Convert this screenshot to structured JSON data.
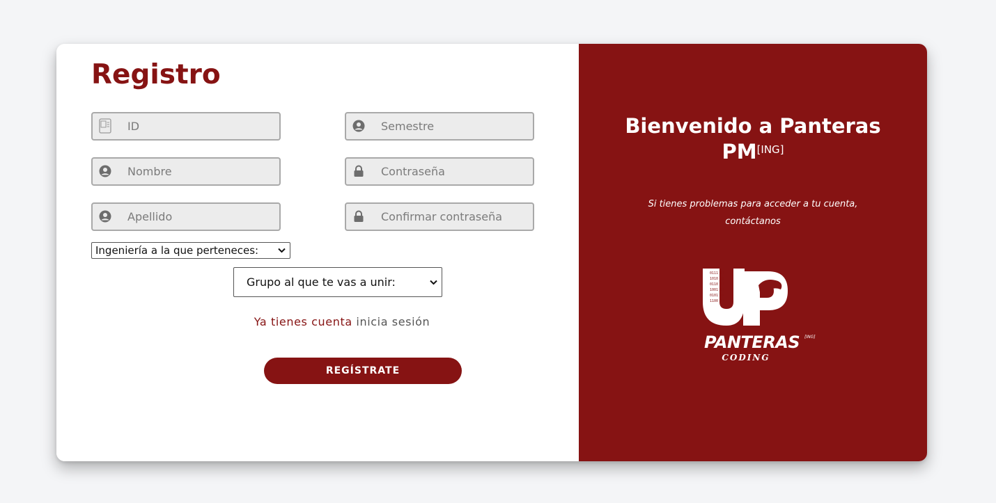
{
  "form": {
    "title": "Registro",
    "fields": {
      "id": {
        "placeholder": "ID",
        "icon": "id-card-icon"
      },
      "semestre": {
        "placeholder": "Semestre",
        "icon": "user-circle-icon"
      },
      "nombre": {
        "placeholder": "Nombre",
        "icon": "user-circle-icon"
      },
      "contrasena": {
        "placeholder": "Contraseña",
        "icon": "lock-icon"
      },
      "apellido": {
        "placeholder": "Apellido",
        "icon": "user-circle-icon"
      },
      "confirmar": {
        "placeholder": "Confirmar contraseña",
        "icon": "lock-icon"
      }
    },
    "ingenieria_select": {
      "selected": "Ingeniería a la que perteneces:"
    },
    "grupo_select": {
      "selected": "Grupo al que te vas a unir:"
    },
    "login_prompt": "Ya tienes cuenta",
    "login_link": "inicia sesión",
    "submit_label": "REGÍSTRATE"
  },
  "welcome_panel": {
    "heading_line1": "Bienvenido a Panteras",
    "heading_line2": "PM",
    "heading_sup": "[ING]",
    "help_line1": "Si tienes problemas para acceder a tu cuenta,",
    "help_line2": "contáctanos",
    "logo": {
      "letters": "UP",
      "brand": "PANTERAS",
      "brand_sup": "[ING]",
      "tagline": "CODING"
    }
  },
  "colors": {
    "accent": "#861313",
    "field_bg": "#ececec",
    "field_border": "#a9a9a9",
    "page_bg": "#f4f5f7"
  }
}
